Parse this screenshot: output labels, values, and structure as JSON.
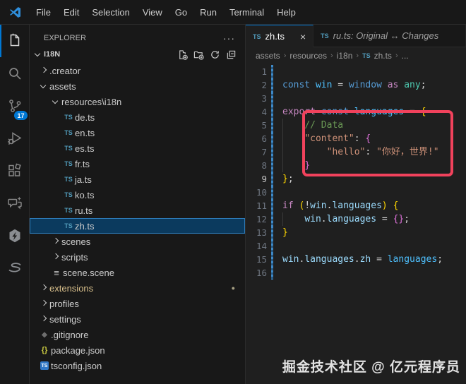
{
  "title_bar": {
    "menus": [
      "File",
      "Edit",
      "Selection",
      "View",
      "Go",
      "Run",
      "Terminal",
      "Help"
    ]
  },
  "activity_bar": {
    "items": [
      {
        "name": "explorer",
        "active": true
      },
      {
        "name": "search",
        "active": false
      },
      {
        "name": "source-control",
        "active": false,
        "badge": "17"
      },
      {
        "name": "run-debug",
        "active": false
      },
      {
        "name": "extensions",
        "active": false
      },
      {
        "name": "chat",
        "active": false
      },
      {
        "name": "extension-hex",
        "active": false
      },
      {
        "name": "extension-s",
        "active": false
      }
    ]
  },
  "explorer": {
    "title": "EXPLORER",
    "overflow": "···",
    "section": {
      "name": "I18N",
      "actions": [
        "new-file",
        "new-folder",
        "refresh",
        "collapse-all"
      ]
    },
    "tree": [
      {
        "label": ".creator",
        "level": 0,
        "kind": "folder",
        "expanded": false
      },
      {
        "label": "assets",
        "level": 0,
        "kind": "folder",
        "expanded": true
      },
      {
        "label": "resources\\i18n",
        "level": 1,
        "kind": "folder",
        "expanded": true
      },
      {
        "label": "de.ts",
        "level": 2,
        "kind": "ts"
      },
      {
        "label": "en.ts",
        "level": 2,
        "kind": "ts"
      },
      {
        "label": "es.ts",
        "level": 2,
        "kind": "ts"
      },
      {
        "label": "fr.ts",
        "level": 2,
        "kind": "ts"
      },
      {
        "label": "ja.ts",
        "level": 2,
        "kind": "ts"
      },
      {
        "label": "ko.ts",
        "level": 2,
        "kind": "ts"
      },
      {
        "label": "ru.ts",
        "level": 2,
        "kind": "ts"
      },
      {
        "label": "zh.ts",
        "level": 2,
        "kind": "ts",
        "selected": true
      },
      {
        "label": "scenes",
        "level": 1,
        "kind": "folder",
        "expanded": false
      },
      {
        "label": "scripts",
        "level": 1,
        "kind": "folder",
        "expanded": false
      },
      {
        "label": "scene.scene",
        "level": 1,
        "kind": "scene"
      },
      {
        "label": "extensions",
        "level": 0,
        "kind": "folder",
        "expanded": false,
        "modified": true,
        "dot": "●"
      },
      {
        "label": "profiles",
        "level": 0,
        "kind": "folder",
        "expanded": false
      },
      {
        "label": "settings",
        "level": 0,
        "kind": "folder",
        "expanded": false
      },
      {
        "label": ".gitignore",
        "level": 0,
        "kind": "git"
      },
      {
        "label": "package.json",
        "level": 0,
        "kind": "json"
      },
      {
        "label": "tsconfig.json",
        "level": 0,
        "kind": "tsconfig"
      }
    ]
  },
  "editor": {
    "tabs": [
      {
        "label": "zh.ts",
        "icon": "TS",
        "active": true,
        "close": "×"
      },
      {
        "label": "ru.ts: Original ↔ Changes",
        "icon": "TS",
        "active": false
      }
    ],
    "breadcrumb": [
      {
        "label": "assets"
      },
      {
        "label": "resources"
      },
      {
        "label": "i18n"
      },
      {
        "label": "zh.ts",
        "icon": "TS"
      },
      {
        "label": "..."
      }
    ],
    "active_line": 9,
    "code": [
      {
        "n": 1,
        "t": []
      },
      {
        "n": 2,
        "t": [
          [
            "const ",
            "kw"
          ],
          [
            "win",
            "var2"
          ],
          [
            " = ",
            "fg"
          ],
          [
            "window",
            "kw"
          ],
          [
            " ",
            "fg"
          ],
          [
            "as",
            "ctl"
          ],
          [
            " ",
            "fg"
          ],
          [
            "any",
            "type"
          ],
          [
            ";",
            "fg"
          ]
        ]
      },
      {
        "n": 3,
        "t": []
      },
      {
        "n": 4,
        "t": [
          [
            "export",
            "ctl"
          ],
          [
            " ",
            "fg"
          ],
          [
            "const ",
            "kw"
          ],
          [
            "languages",
            "var2"
          ],
          [
            " = ",
            "fg"
          ],
          [
            "{",
            "b1"
          ]
        ]
      },
      {
        "n": 5,
        "g": [
          0
        ],
        "t": [
          [
            "    ",
            "fg"
          ],
          [
            "// Data",
            "com"
          ]
        ]
      },
      {
        "n": 6,
        "g": [
          0
        ],
        "t": [
          [
            "    ",
            "fg"
          ],
          [
            "\"content\"",
            "str"
          ],
          [
            ": ",
            "fg"
          ],
          [
            "{",
            "b2"
          ]
        ]
      },
      {
        "n": 7,
        "g": [
          0,
          4
        ],
        "t": [
          [
            "        ",
            "fg"
          ],
          [
            "\"hello\"",
            "str"
          ],
          [
            ": ",
            "fg"
          ],
          [
            "\"你好，世界!\"",
            "str"
          ]
        ]
      },
      {
        "n": 8,
        "g": [
          0
        ],
        "t": [
          [
            "    ",
            "fg"
          ],
          [
            "}",
            "b2"
          ]
        ]
      },
      {
        "n": 9,
        "t": [
          [
            "}",
            "b1"
          ],
          [
            ";",
            "fg"
          ]
        ]
      },
      {
        "n": 10,
        "t": []
      },
      {
        "n": 11,
        "t": [
          [
            "if",
            "ctl"
          ],
          [
            " ",
            "fg"
          ],
          [
            "(",
            "b1"
          ],
          [
            "!",
            "fg"
          ],
          [
            "win",
            "var"
          ],
          [
            ".",
            "fg"
          ],
          [
            "languages",
            "var"
          ],
          [
            ")",
            "b1"
          ],
          [
            " ",
            "fg"
          ],
          [
            "{",
            "b1"
          ]
        ]
      },
      {
        "n": 12,
        "g": [
          0
        ],
        "t": [
          [
            "    ",
            "fg"
          ],
          [
            "win",
            "var"
          ],
          [
            ".",
            "fg"
          ],
          [
            "languages",
            "var"
          ],
          [
            " = ",
            "fg"
          ],
          [
            "{}",
            "b2"
          ],
          [
            ";",
            "fg"
          ]
        ]
      },
      {
        "n": 13,
        "t": [
          [
            "}",
            "b1"
          ]
        ]
      },
      {
        "n": 14,
        "t": []
      },
      {
        "n": 15,
        "t": [
          [
            "win",
            "var"
          ],
          [
            ".",
            "fg"
          ],
          [
            "languages",
            "var"
          ],
          [
            ".",
            "fg"
          ],
          [
            "zh",
            "var"
          ],
          [
            " = ",
            "fg"
          ],
          [
            "languages",
            "var2"
          ],
          [
            ";",
            "fg"
          ]
        ]
      },
      {
        "n": 16,
        "t": []
      }
    ],
    "watermark": "掘金技术社区 @ 亿元程序员"
  },
  "colors": {
    "accent": "#0078d4",
    "badge_bg": "#0078d4",
    "selection_bg": "#0b3a5e",
    "selection_border": "#2d7bb8",
    "modified_item": "#d9c08c",
    "annotation_red": "#f1425c",
    "ts_icon": "#519aba",
    "syntax": {
      "kw": "#569cd6",
      "ctl": "#c586c0",
      "var": "#9cdcfe",
      "var2": "#4fc1ff",
      "type": "#4ec9b0",
      "str": "#ce9178",
      "com": "#6a9955",
      "fg": "#d4d4d4",
      "b1": "#ffd700",
      "b2": "#da70d6"
    }
  }
}
